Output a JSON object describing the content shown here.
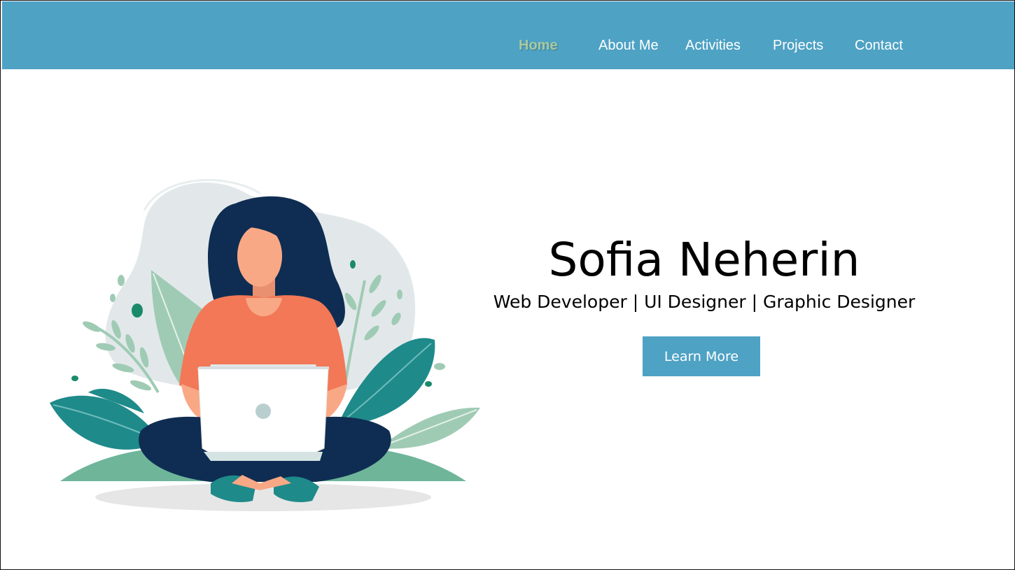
{
  "nav": {
    "items": [
      {
        "label": "Home",
        "active": true
      },
      {
        "label": "About Me",
        "active": false
      },
      {
        "label": "Activities",
        "active": false
      },
      {
        "label": "Projects",
        "active": false
      },
      {
        "label": "Contact",
        "active": false
      }
    ]
  },
  "hero": {
    "name": "Sofia Neherin",
    "tagline": "Web Developer | UI Designer | Graphic Designer",
    "cta_label": "Learn More"
  },
  "illustration": {
    "icon": "woman-with-laptop-illustration"
  },
  "colors": {
    "navbar": "#4ea2c4",
    "active_link": "#a9c9a0",
    "button": "#4ea2c4",
    "hair": "#0f2d52",
    "shirt": "#f27857",
    "skin": "#f9a886",
    "leaf_dark": "#1f8a8a",
    "leaf_light": "#9fcbb4"
  }
}
